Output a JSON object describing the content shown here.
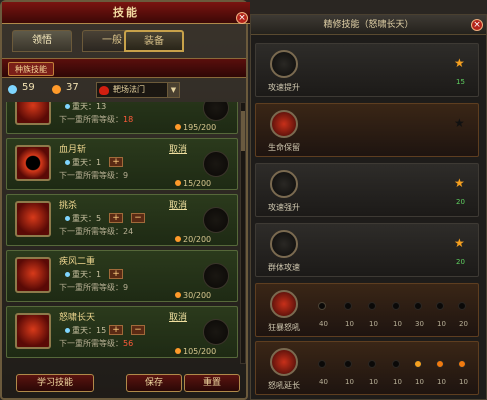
{
  "window": {
    "title": "技能",
    "close": "×"
  },
  "tabs": [
    {
      "label": "领悟"
    },
    {
      "label": "一般"
    },
    {
      "label": "装备"
    }
  ],
  "subtab": {
    "label": "种族技能"
  },
  "stats": {
    "points": "59",
    "orbs": "37",
    "dropdown": "靶场法门",
    "arrow": "▼"
  },
  "skills": [
    {
      "name": "",
      "level": "重天：13",
      "req_label": "下一重所需等级：",
      "req_val": "18",
      "xp": "195/200"
    },
    {
      "name": "血月斩",
      "level": "重天：1",
      "req_label": "下一重所需等级：",
      "req_val": "9",
      "xp": "15/200",
      "remove": "取消"
    },
    {
      "name": "挑杀",
      "level": "重天：5",
      "req_label": "下一重所需等级：",
      "req_val": "24",
      "xp": "20/200",
      "remove": "取消"
    },
    {
      "name": "疾风二重",
      "level": "重天：1",
      "req_label": "下一重所需等级：",
      "req_val": "9",
      "xp": "30/200",
      "remove": "取消"
    },
    {
      "name": "怒啸长天",
      "level": "重天：15",
      "req_label": "下一重所需等级：",
      "req_val": "56",
      "xp": "105/200",
      "remove": "取消"
    }
  ],
  "buttons": {
    "learn": "学习技能",
    "save": "保存",
    "reset": "重置"
  },
  "right": {
    "title": "精修技能（怒啸长天）",
    "close": "×",
    "cards": [
      {
        "label": "攻速提升",
        "value": "15"
      },
      {
        "label": "生命保留",
        "value": ""
      },
      {
        "label": "攻速强升",
        "value": "20"
      },
      {
        "label": "群体攻速",
        "value": "20"
      },
      {
        "label": "狂暴怒吼",
        "pips": [
          "40",
          "10",
          "10",
          "10",
          "30",
          "10",
          "20"
        ]
      },
      {
        "label": "怒吼延长",
        "pips": [
          "40",
          "10",
          "10",
          "10",
          "10",
          "10",
          "10"
        ]
      }
    ]
  },
  "colors": {
    "accent": "#b3231a",
    "gold": "#f5a020",
    "green": "#5fd060"
  },
  "icons": {
    "star": "★",
    "plus": "+",
    "minus": "−"
  }
}
